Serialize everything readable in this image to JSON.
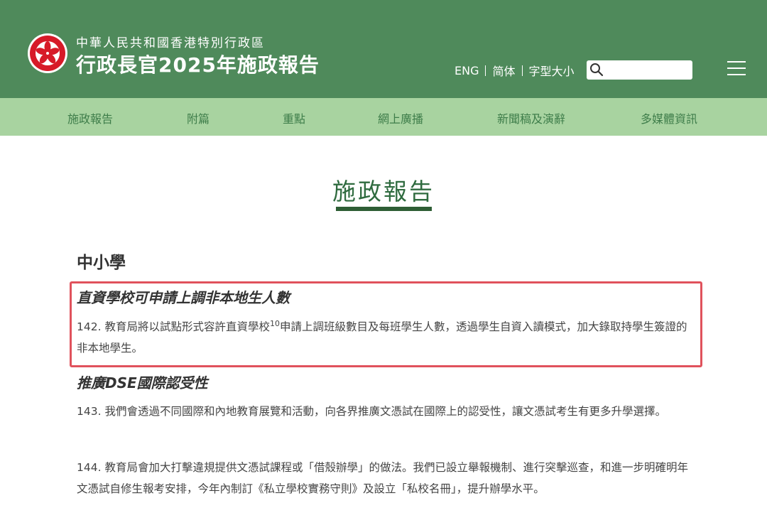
{
  "header": {
    "org_title": "中華人民共和國香港特別行政區",
    "main_title": "行政長官2025年施政報告",
    "colors": {
      "header_bg": "#4f8a5b",
      "nav_bg": "#a8d3a0",
      "nav_text": "#3e7d4a",
      "highlight_border": "#e0525c"
    }
  },
  "lang_bar": {
    "eng": "ENG",
    "simplified": "简体",
    "font_size": "字型大小"
  },
  "search": {
    "placeholder": "",
    "icon": "search-icon"
  },
  "menu": {
    "icon": "hamburger-menu-icon"
  },
  "nav": {
    "items": [
      {
        "label": "施政報告"
      },
      {
        "label": "附篇"
      },
      {
        "label": "重點"
      },
      {
        "label": "網上廣播"
      },
      {
        "label": "新聞稿及演辭"
      },
      {
        "label": "多媒體資訊"
      }
    ]
  },
  "page": {
    "title": "施政報告",
    "section_heading": "中小學",
    "items": [
      {
        "heading": "直資學校可申請上調非本地生人數",
        "number": "142.",
        "text_before": "教育局將以試點形式容許直資學校",
        "footnote": "10",
        "text_after": "申請上調班級數目及每班學生人數，透過學生自資入讀模式，加大錄取持學生簽證的非本地學生。"
      },
      {
        "heading": "推廣DSE國際認受性",
        "number": "143.",
        "text": "我們會透過不同國際和內地教育展覽和活動，向各界推廣文憑試在國際上的認受性，讓文憑試考生有更多升學選擇。"
      },
      {
        "number": "144.",
        "text": "教育局會加大打擊違規提供文憑試課程或「借殼辦學」的做法。我們已設立舉報機制、進行突擊巡查，和進一步明確明年文憑試自修生報考安排，今年內制訂《私立學校實務守則》及設立「私校名冊」，提升辦學水平。"
      }
    ]
  }
}
